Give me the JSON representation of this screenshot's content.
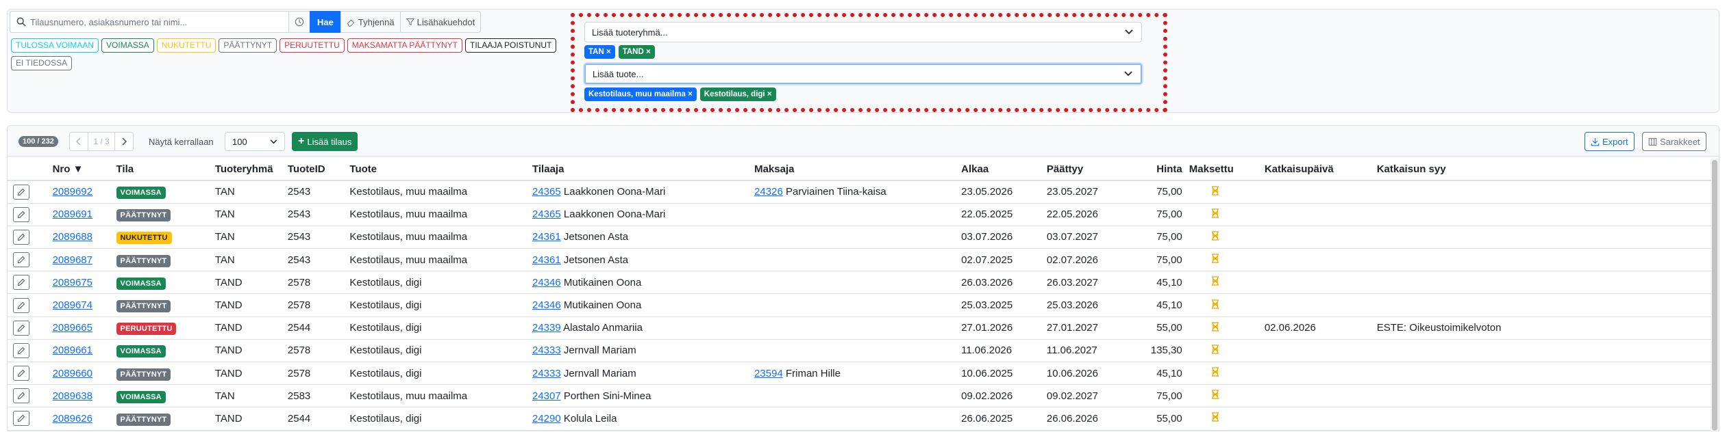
{
  "search": {
    "placeholder": "Tilausnumero, asiakasnumero tai nimi...",
    "search_label": "Hae",
    "clear_label": "Tyhjennä",
    "more_label": "Lisähakuehdot"
  },
  "status_chips": [
    {
      "label": "TULOSSA VOIMAAN",
      "color": "#0dcaf0"
    },
    {
      "label": "VOIMASSA",
      "color": "#198754"
    },
    {
      "label": "NUKUTETTU",
      "color": "#ffc107"
    },
    {
      "label": "PÄÄTTYNYT",
      "color": "#6c757d"
    },
    {
      "label": "PERUUTETTU",
      "color": "#dc3545"
    },
    {
      "label": "MAKSAMATTA PÄÄTTYNYT",
      "color": "#dc3545"
    },
    {
      "label": "TILAAJA POISTUNUT",
      "color": "#212529"
    },
    {
      "label": "EI TIEDOSSA",
      "color": "#6c757d"
    }
  ],
  "product_group_select": {
    "placeholder": "Lisää tuoteryhmä...",
    "tags": [
      {
        "label": "TAN",
        "color": "#0d6efd"
      },
      {
        "label": "TAND",
        "color": "#198754"
      }
    ]
  },
  "product_select": {
    "placeholder": "Lisää tuote...",
    "tags": [
      {
        "label": "Kestotilaus, muu maailma",
        "color": "#0d6efd"
      },
      {
        "label": "Kestotilaus, digi",
        "color": "#198754"
      }
    ]
  },
  "toolbar": {
    "count": "100 / 232",
    "page": "1 / 3",
    "per_page_label": "Näytä kerrallaan",
    "per_page": "100",
    "add_label": "Lisää tilaus",
    "export_label": "Export",
    "columns_label": "Sarakkeet"
  },
  "columns": [
    "Nro ▼",
    "Tila",
    "Tuoteryhmä",
    "TuoteID",
    "Tuote",
    "Tilaaja",
    "Maksaja",
    "Alkaa",
    "Päättyy",
    "Hinta",
    "Maksettu",
    "Katkaisupäivä",
    "Katkaisun syy"
  ],
  "status_colors": {
    "VOIMASSA": "#198754",
    "PÄÄTTYNYT": "#6c757d",
    "NUKUTETTU": "#ffc107",
    "PERUUTETTU": "#dc3545"
  },
  "rows": [
    {
      "nro": "2089692",
      "tila": "VOIMASSA",
      "ryhma": "TAN",
      "id": "2543",
      "tuote": "Kestotilaus, muu maailma",
      "tilaaja_no": "24365",
      "tilaaja": "Laakkonen Oona-Mari",
      "maksaja_no": "24326",
      "maksaja": "Parviainen Tiina-kaisa",
      "alkaa": "23.05.2026",
      "paattyy": "23.05.2027",
      "hinta": "75,00",
      "katk_pv": "",
      "katk_syy": ""
    },
    {
      "nro": "2089691",
      "tila": "PÄÄTTYNYT",
      "ryhma": "TAN",
      "id": "2543",
      "tuote": "Kestotilaus, muu maailma",
      "tilaaja_no": "24365",
      "tilaaja": "Laakkonen Oona-Mari",
      "maksaja_no": "",
      "maksaja": "",
      "alkaa": "22.05.2025",
      "paattyy": "22.05.2026",
      "hinta": "75,00",
      "katk_pv": "",
      "katk_syy": ""
    },
    {
      "nro": "2089688",
      "tila": "NUKUTETTU",
      "ryhma": "TAN",
      "id": "2543",
      "tuote": "Kestotilaus, muu maailma",
      "tilaaja_no": "24361",
      "tilaaja": "Jetsonen Asta",
      "maksaja_no": "",
      "maksaja": "",
      "alkaa": "03.07.2026",
      "paattyy": "03.07.2027",
      "hinta": "75,00",
      "katk_pv": "",
      "katk_syy": ""
    },
    {
      "nro": "2089687",
      "tila": "PÄÄTTYNYT",
      "ryhma": "TAN",
      "id": "2543",
      "tuote": "Kestotilaus, muu maailma",
      "tilaaja_no": "24361",
      "tilaaja": "Jetsonen Asta",
      "maksaja_no": "",
      "maksaja": "",
      "alkaa": "02.07.2025",
      "paattyy": "02.07.2026",
      "hinta": "75,00",
      "katk_pv": "",
      "katk_syy": ""
    },
    {
      "nro": "2089675",
      "tila": "VOIMASSA",
      "ryhma": "TAND",
      "id": "2578",
      "tuote": "Kestotilaus, digi",
      "tilaaja_no": "24346",
      "tilaaja": "Mutikainen Oona",
      "maksaja_no": "",
      "maksaja": "",
      "alkaa": "26.03.2026",
      "paattyy": "26.03.2027",
      "hinta": "45,10",
      "katk_pv": "",
      "katk_syy": ""
    },
    {
      "nro": "2089674",
      "tila": "PÄÄTTYNYT",
      "ryhma": "TAND",
      "id": "2578",
      "tuote": "Kestotilaus, digi",
      "tilaaja_no": "24346",
      "tilaaja": "Mutikainen Oona",
      "maksaja_no": "",
      "maksaja": "",
      "alkaa": "25.03.2025",
      "paattyy": "25.03.2026",
      "hinta": "45,10",
      "katk_pv": "",
      "katk_syy": ""
    },
    {
      "nro": "2089665",
      "tila": "PERUUTETTU",
      "ryhma": "TAND",
      "id": "2544",
      "tuote": "Kestotilaus, digi",
      "tilaaja_no": "24339",
      "tilaaja": "Alastalo Anmariia",
      "maksaja_no": "",
      "maksaja": "",
      "alkaa": "27.01.2026",
      "paattyy": "27.01.2027",
      "hinta": "55,00",
      "katk_pv": "02.06.2026",
      "katk_syy": "ESTE: Oikeustoimikelvoton"
    },
    {
      "nro": "2089661",
      "tila": "VOIMASSA",
      "ryhma": "TAND",
      "id": "2578",
      "tuote": "Kestotilaus, digi",
      "tilaaja_no": "24333",
      "tilaaja": "Jernvall Mariam",
      "maksaja_no": "",
      "maksaja": "",
      "alkaa": "11.06.2026",
      "paattyy": "11.06.2027",
      "hinta": "135,30",
      "katk_pv": "",
      "katk_syy": ""
    },
    {
      "nro": "2089660",
      "tila": "PÄÄTTYNYT",
      "ryhma": "TAND",
      "id": "2578",
      "tuote": "Kestotilaus, digi",
      "tilaaja_no": "24333",
      "tilaaja": "Jernvall Mariam",
      "maksaja_no": "23594",
      "maksaja": "Friman Hille",
      "alkaa": "10.06.2025",
      "paattyy": "10.06.2026",
      "hinta": "45,10",
      "katk_pv": "",
      "katk_syy": ""
    },
    {
      "nro": "2089638",
      "tila": "VOIMASSA",
      "ryhma": "TAN",
      "id": "2583",
      "tuote": "Kestotilaus, muu maailma",
      "tilaaja_no": "24307",
      "tilaaja": "Porthen Sini-Minea",
      "maksaja_no": "",
      "maksaja": "",
      "alkaa": "09.02.2026",
      "paattyy": "09.02.2027",
      "hinta": "75,00",
      "katk_pv": "",
      "katk_syy": ""
    },
    {
      "nro": "2089626",
      "tila": "PÄÄTTYNYT",
      "ryhma": "TAND",
      "id": "2544",
      "tuote": "Kestotilaus, digi",
      "tilaaja_no": "24290",
      "tilaaja": "Kolula Leila",
      "maksaja_no": "",
      "maksaja": "",
      "alkaa": "26.06.2025",
      "paattyy": "26.06.2026",
      "hinta": "55,00",
      "katk_pv": "",
      "katk_syy": ""
    }
  ]
}
